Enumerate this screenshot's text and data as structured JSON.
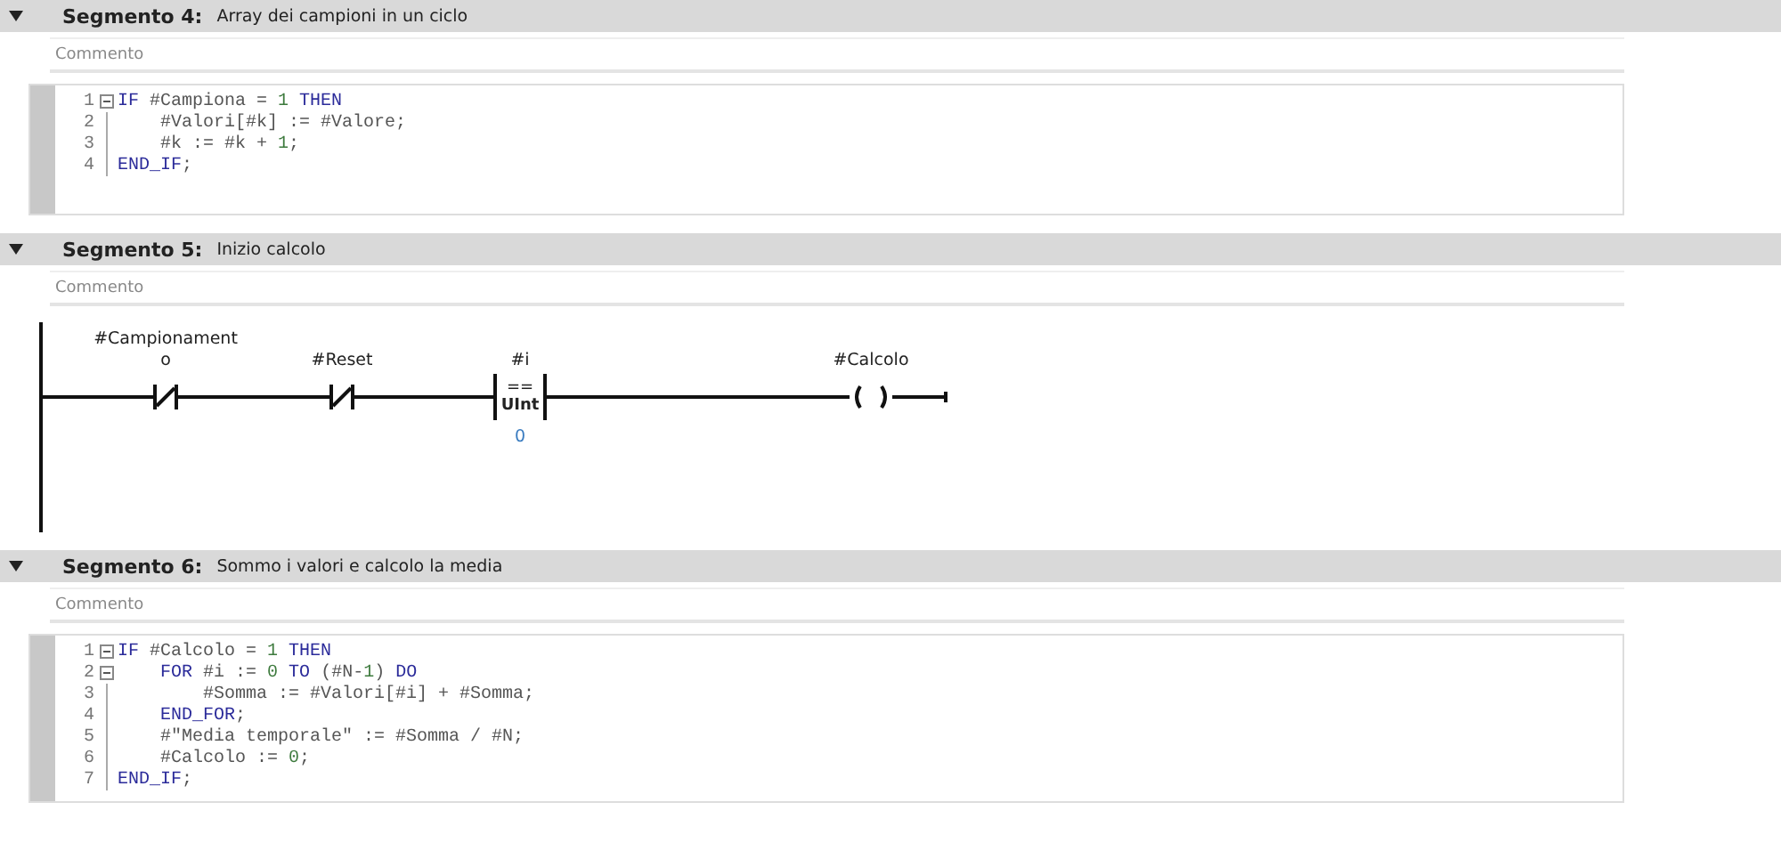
{
  "segments": [
    {
      "kind": "code",
      "title": "Segmento 4:",
      "description": "Array dei campioni in un ciclo",
      "expanded": true,
      "comment_placeholder": "Commento",
      "lines": [
        {
          "number": "1",
          "fold": true,
          "tokens": [
            {
              "kind": "keyword",
              "text": "IF"
            },
            {
              "kind": "text",
              "text": " #Campiona = "
            },
            {
              "kind": "number",
              "text": "1"
            },
            {
              "kind": "keyword",
              "text": " THEN"
            }
          ]
        },
        {
          "number": "2",
          "fold": false,
          "tokens": [
            {
              "kind": "text",
              "text": "    #Valori[#k] := #Valore;"
            }
          ]
        },
        {
          "number": "3",
          "fold": false,
          "tokens": [
            {
              "kind": "text",
              "text": "    #k := #k + "
            },
            {
              "kind": "number",
              "text": "1"
            },
            {
              "kind": "text",
              "text": ";"
            }
          ]
        },
        {
          "number": "4",
          "fold": false,
          "tokens": [
            {
              "kind": "keyword",
              "text": "END_IF"
            },
            {
              "kind": "text",
              "text": ";"
            }
          ]
        }
      ]
    },
    {
      "kind": "ladder",
      "title": "Segmento 5:",
      "description": "Inizio calcolo",
      "expanded": true,
      "comment_placeholder": "Commento",
      "rung": [
        {
          "kind": "nc_contact",
          "label_lines": [
            "#Campionament",
            "o"
          ]
        },
        {
          "kind": "nc_contact",
          "label_lines": [
            "#Reset"
          ]
        },
        {
          "kind": "compare",
          "operand": "#i",
          "operator": "==",
          "type": "UInt",
          "value": "0"
        },
        {
          "kind": "coil",
          "label_lines": [
            "#Calcolo"
          ]
        }
      ]
    },
    {
      "kind": "code",
      "title": "Segmento 6:",
      "description": "Sommo i valori e calcolo la media",
      "expanded": true,
      "comment_placeholder": "Commento",
      "lines": [
        {
          "number": "1",
          "fold": true,
          "tokens": [
            {
              "kind": "keyword",
              "text": "IF"
            },
            {
              "kind": "text",
              "text": " #Calcolo = "
            },
            {
              "kind": "number",
              "text": "1"
            },
            {
              "kind": "keyword",
              "text": " THEN"
            }
          ]
        },
        {
          "number": "2",
          "fold": true,
          "tokens": [
            {
              "kind": "keyword",
              "text": "    FOR"
            },
            {
              "kind": "text",
              "text": " #i := "
            },
            {
              "kind": "number",
              "text": "0"
            },
            {
              "kind": "keyword",
              "text": " TO"
            },
            {
              "kind": "text",
              "text": " (#N-"
            },
            {
              "kind": "number",
              "text": "1"
            },
            {
              "kind": "text",
              "text": ") "
            },
            {
              "kind": "keyword",
              "text": "DO"
            }
          ]
        },
        {
          "number": "3",
          "fold": false,
          "tokens": [
            {
              "kind": "text",
              "text": "        #Somma := #Valori[#i] + #Somma;"
            }
          ]
        },
        {
          "number": "4",
          "fold": false,
          "tokens": [
            {
              "kind": "keyword",
              "text": "    END_FOR"
            },
            {
              "kind": "text",
              "text": ";"
            }
          ]
        },
        {
          "number": "5",
          "fold": false,
          "tokens": [
            {
              "kind": "text",
              "text": "    #\"Media temporale\" := #Somma / #N;"
            }
          ]
        },
        {
          "number": "6",
          "fold": false,
          "tokens": [
            {
              "kind": "text",
              "text": "    #Calcolo := "
            },
            {
              "kind": "number",
              "text": "0"
            },
            {
              "kind": "text",
              "text": ";"
            }
          ]
        },
        {
          "number": "7",
          "fold": false,
          "tokens": [
            {
              "kind": "keyword",
              "text": "END_IF"
            },
            {
              "kind": "text",
              "text": ";"
            }
          ]
        }
      ]
    }
  ]
}
